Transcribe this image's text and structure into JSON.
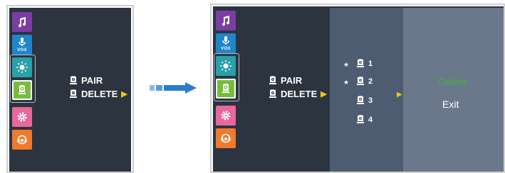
{
  "screens": [
    {
      "sidebar": [
        "music-icon",
        "vox-mic-icon",
        "brightness-icon",
        "camera-icon",
        "settings-icon",
        "support-icon"
      ],
      "menu": {
        "items": [
          {
            "label": "PAIR"
          },
          {
            "label": "DELETE"
          }
        ],
        "selected": "DELETE"
      }
    },
    {
      "sidebar": [
        "music-icon",
        "vox-mic-icon",
        "brightness-icon",
        "camera-icon",
        "settings-icon",
        "support-icon"
      ],
      "menu": {
        "items": [
          {
            "label": "PAIR"
          },
          {
            "label": "DELETE"
          }
        ],
        "selected": "DELETE"
      },
      "camera_list": [
        {
          "num": "1",
          "starred": true
        },
        {
          "num": "2",
          "starred": true
        },
        {
          "num": "3",
          "starred": false
        },
        {
          "num": "4",
          "starred": false
        }
      ],
      "options": {
        "delete_label": "Delete",
        "exit_label": "Exit"
      }
    }
  ],
  "sidebar_labels": {
    "vox": "VOX"
  },
  "colors": {
    "background": "#2c3440",
    "music": "#7a3ea3",
    "vox": "#1f86c7",
    "brightness": "#2aa0a8",
    "camera": "#78bc3c",
    "settings": "#e8689a",
    "support": "#ee7a2e",
    "arrow_blue": "#2a7ccc",
    "selected_option": "#3fb23f",
    "accent_arrow": "#f5c518"
  }
}
